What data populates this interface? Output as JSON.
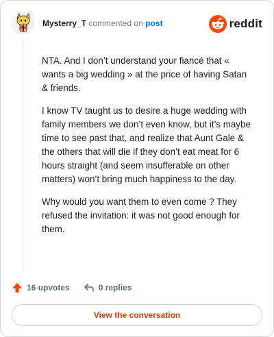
{
  "header": {
    "username": "Mysterry_T",
    "commented_text": "commented on",
    "post_link": "post",
    "brand": "reddit",
    "avatar_icon": "snoo-avatar-icon",
    "brand_icon": "reddit-snoo-icon",
    "brand_color": "#ff4500"
  },
  "comment": {
    "paragraphs": [
      "NTA. And I don’t understand your fiancé that « wants a big wedding » at the price of having Satan & friends.",
      "I know TV taught us to desire a huge wedding with family members we don’t even know, but it’s maybe time to see past that, and realize that Aunt Gale & the others that will die if they don’t eat meat for 6 hours straight (and seem insufferable on other matters) won’t bring much happiness to the day.",
      "Why would you want them to even come ? They refused the invitation: it was not good enough for them."
    ]
  },
  "actions": {
    "upvotes": "16 upvotes",
    "replies": "0 replies",
    "upvote_icon": "upvote-arrow-icon",
    "reply_icon": "reply-arrow-icon"
  },
  "cta": {
    "label": "View the conversation"
  }
}
